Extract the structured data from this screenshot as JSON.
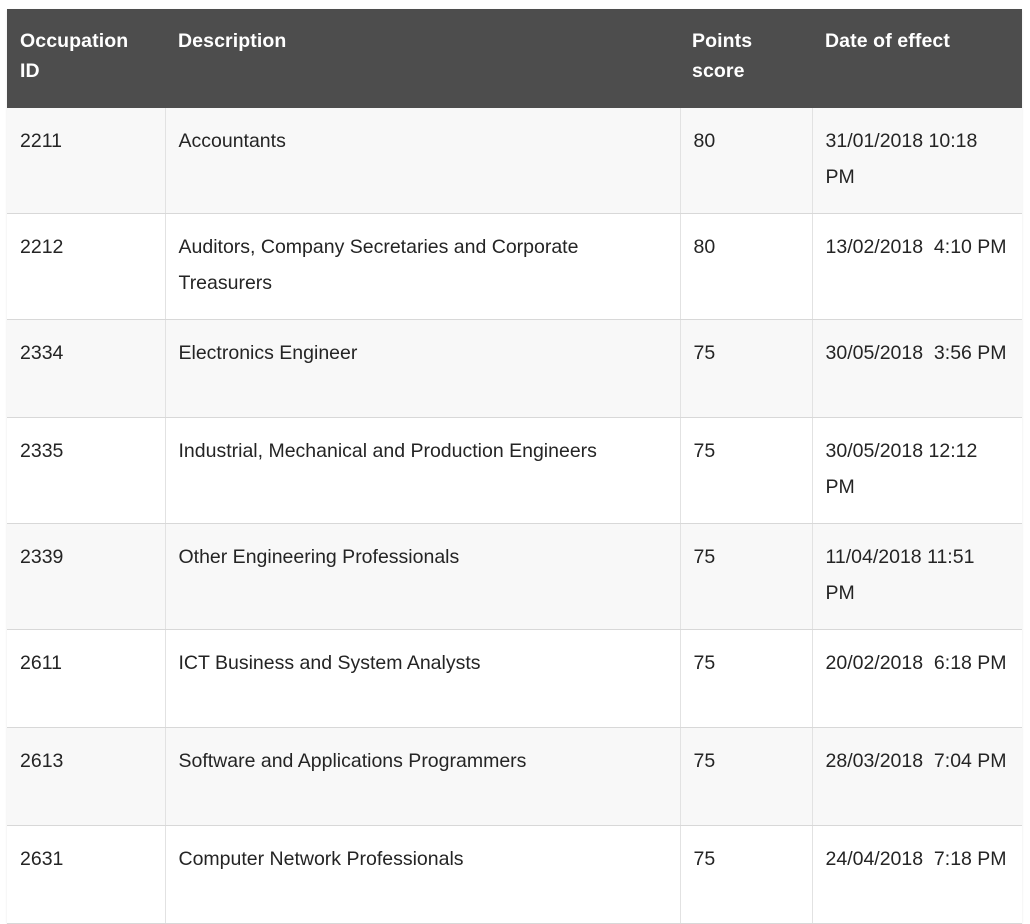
{
  "table": {
    "name": "skilled-occupation-points-table",
    "colors": {
      "header_bg": "#4d4d4d",
      "header_text": "#ffffff",
      "row_odd_bg": "#f8f8f8",
      "row_even_bg": "#ffffff",
      "cell_text": "#242424",
      "border": "#d8d8d8",
      "page_bg": "#ffffff"
    },
    "columns": [
      {
        "key": "occupation_id",
        "label": "Occupation ID"
      },
      {
        "key": "description",
        "label": "Description"
      },
      {
        "key": "points_score",
        "label": "Points score"
      },
      {
        "key": "date_of_effect",
        "label": "Date of effect"
      }
    ],
    "rows": [
      {
        "occupation_id": "2211",
        "description": "Accountants",
        "points_score": "80",
        "date_of_effect": "31/01/2018 10:18 PM"
      },
      {
        "occupation_id": "2212",
        "description": "Auditors, Company Secretaries and Corporate Treasurers",
        "points_score": "80",
        "date_of_effect": "13/02/2018  4:10 PM"
      },
      {
        "occupation_id": "2334",
        "description": "Electronics Engineer",
        "points_score": "75",
        "date_of_effect": "30/05/2018  3:56 PM"
      },
      {
        "occupation_id": "2335",
        "description": "Industrial, Mechanical and Production Engineers",
        "points_score": "75",
        "date_of_effect": "30/05/2018 12:12 PM"
      },
      {
        "occupation_id": "2339",
        "description": "Other Engineering Professionals",
        "points_score": "75",
        "date_of_effect": "11/04/2018 11:51 PM"
      },
      {
        "occupation_id": "2611",
        "description": "ICT Business and System Analysts",
        "points_score": "75",
        "date_of_effect": "20/02/2018  6:18 PM"
      },
      {
        "occupation_id": "2613",
        "description": "Software and Applications Programmers",
        "points_score": "75",
        "date_of_effect": "28/03/2018  7:04 PM"
      },
      {
        "occupation_id": "2631",
        "description": "Computer Network Professionals",
        "points_score": "75",
        "date_of_effect": "24/04/2018  7:18 PM"
      }
    ]
  }
}
